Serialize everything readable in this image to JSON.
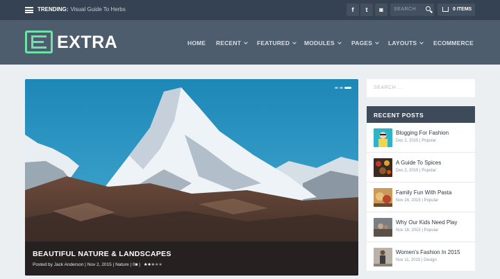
{
  "topbar": {
    "trending_label": "TRENDING:",
    "trending_text": "Visual Guide To Herbs",
    "social": [
      {
        "icon": "facebook-icon",
        "glyph": "f"
      },
      {
        "icon": "twitter-icon",
        "glyph": "t"
      },
      {
        "icon": "instagram-icon",
        "glyph": "◙"
      }
    ],
    "search_placeholder": "SEARCH",
    "cart_label": "0 ITEMS"
  },
  "header": {
    "logo_text": "EXTRA",
    "nav": [
      {
        "label": "HOME",
        "dropdown": false
      },
      {
        "label": "RECENT",
        "dropdown": true
      },
      {
        "label": "FEATURED",
        "dropdown": true
      },
      {
        "label": "MODULES",
        "dropdown": true
      },
      {
        "label": "PAGES",
        "dropdown": true
      },
      {
        "label": "LAYOUTS",
        "dropdown": true
      },
      {
        "label": "ECOMMERCE",
        "dropdown": false
      }
    ]
  },
  "hero": {
    "title": "BEAUTIFUL NATURE & LANDSCAPES",
    "meta_prefix": "Posted by",
    "author": "Jack Anderson",
    "date": "Nov 2, 2015",
    "category": "Nature",
    "comments": "0",
    "rating": 2.5,
    "rating_max": 5,
    "slides_total": 3,
    "slide_active": 3
  },
  "sidebar": {
    "search_placeholder": "SEARCH ...",
    "recent_heading": "RECENT POSTS",
    "posts": [
      {
        "title": "Blogging For Fashion",
        "date": "Dec 2, 2015",
        "category": "Popular"
      },
      {
        "title": "A Guide To Spices",
        "date": "Dec 2, 2015",
        "category": "Popular"
      },
      {
        "title": "Family Fun With Pasta",
        "date": "Nov 24, 2015",
        "category": "Popular"
      },
      {
        "title": "Why Our Kids Need Play",
        "date": "Nov 18, 2015",
        "category": "Popular"
      },
      {
        "title": "Women's Fashion In 2015",
        "date": "Nov 11, 2015",
        "category": "Design"
      }
    ]
  },
  "colors": {
    "topbar": "#344251",
    "header": "#4e5d6e",
    "accent": "#6ee3a8",
    "widget_head": "#3c4a59",
    "page_bg": "#eceff2"
  }
}
